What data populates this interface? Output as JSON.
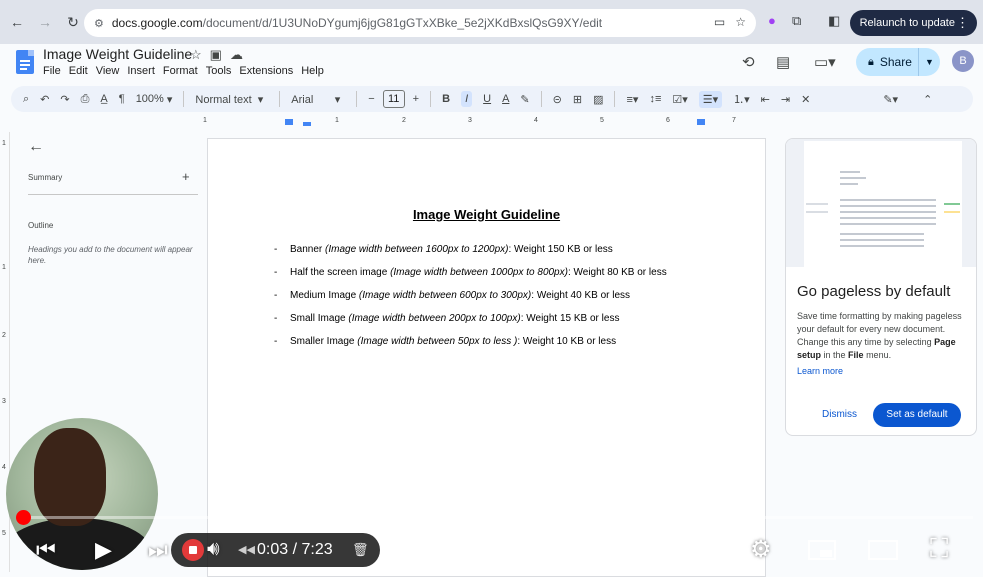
{
  "browser": {
    "url_host": "docs.google.com",
    "url_path": "/document/d/1U3UNoDYgumj6jgG81gGTxXBke_5e2jXKdBxslQsG9XY/edit",
    "relaunch_label": "Relaunch to update",
    "profile_initial": "B"
  },
  "docs": {
    "title": "Image Weight Guideline",
    "menu": [
      "File",
      "Edit",
      "View",
      "Insert",
      "Format",
      "Tools",
      "Extensions",
      "Help"
    ],
    "share_label": "Share",
    "account_initial": "B"
  },
  "toolbar": {
    "zoom": "100%",
    "style": "Normal text",
    "font": "Arial",
    "font_size": "11"
  },
  "ruler": {
    "h_labels": [
      "1",
      "1",
      "2",
      "3",
      "4",
      "5",
      "6",
      "7"
    ],
    "v_labels": [
      "1",
      "1",
      "2",
      "3",
      "4",
      "5"
    ]
  },
  "outline": {
    "summary_label": "Summary",
    "outline_label": "Outline",
    "hint": "Headings you add to the document will appear here."
  },
  "document": {
    "heading": "Image Weight Guideline",
    "items": [
      {
        "prefix": "Banner ",
        "italic": "(Image width between 1600px to 1200px)",
        "suffix": ": Weight 150 KB or less"
      },
      {
        "prefix": "Half the screen image ",
        "italic": "(Image width between 1000px to 800px)",
        "suffix": ": Weight 80 KB or less"
      },
      {
        "prefix": "Medium Image ",
        "italic": "(Image width between 600px to 300px)",
        "suffix": ": Weight 40 KB or less"
      },
      {
        "prefix": "Small Image ",
        "italic": "(Image width between 200px to 100px)",
        "suffix": ": Weight 15 KB or less"
      },
      {
        "prefix": "Smaller Image ",
        "italic": "(Image width between 50px to less )",
        "suffix": ": Weight 10 KB or less"
      }
    ]
  },
  "side_card": {
    "title": "Go pageless by default",
    "body_1": "Save time formatting by making pageless your default for every new document. Change this any time by selecting ",
    "body_bold_1": "Page setup",
    "body_2": " in the ",
    "body_bold_2": "File",
    "body_3": " menu.",
    "learn_more": "Learn more",
    "dismiss": "Dismiss",
    "set_default": "Set as default"
  },
  "player": {
    "time": "0:03 / 7:23",
    "cc_label": "CC"
  }
}
